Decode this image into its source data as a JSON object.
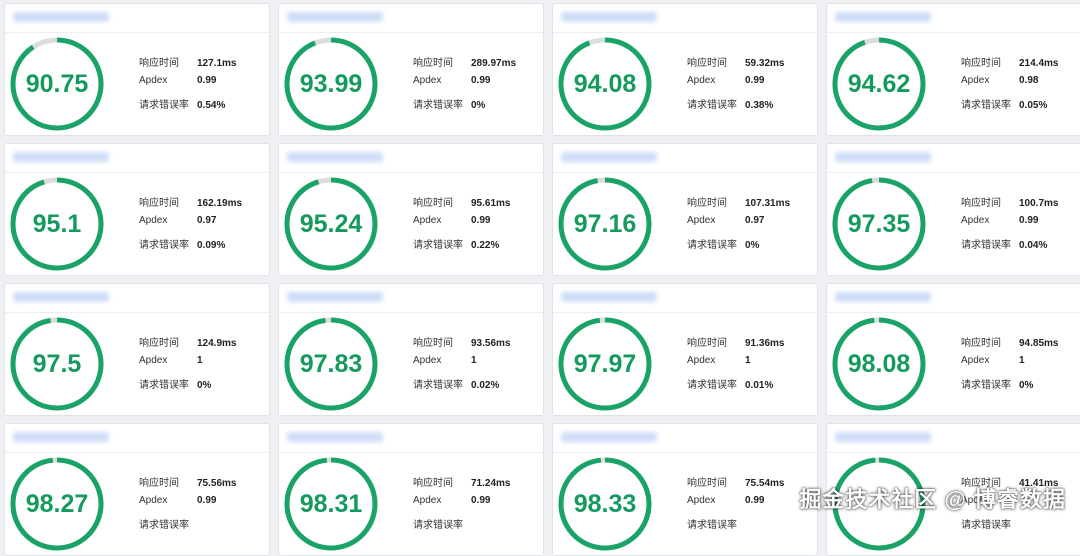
{
  "labels": {
    "response_time": "响应时间",
    "apdex": "Apdex",
    "error_rate": "请求错误率"
  },
  "colors": {
    "gauge_fill": "#1aa366",
    "gauge_track": "#dcdcdc",
    "score_text": "#159a5e"
  },
  "cards": [
    {
      "score": "90.75",
      "fill": 0.9075,
      "response_time": "127.1ms",
      "apdex": "0.99",
      "error_rate": "0.54%"
    },
    {
      "score": "93.99",
      "fill": 0.9399,
      "response_time": "289.97ms",
      "apdex": "0.99",
      "error_rate": "0%"
    },
    {
      "score": "94.08",
      "fill": 0.9408,
      "response_time": "59.32ms",
      "apdex": "0.99",
      "error_rate": "0.38%"
    },
    {
      "score": "94.62",
      "fill": 0.9462,
      "response_time": "214.4ms",
      "apdex": "0.98",
      "error_rate": "0.05%"
    },
    {
      "score": "95.1",
      "fill": 0.951,
      "response_time": "162.19ms",
      "apdex": "0.97",
      "error_rate": "0.09%"
    },
    {
      "score": "95.24",
      "fill": 0.9524,
      "response_time": "95.61ms",
      "apdex": "0.99",
      "error_rate": "0.22%"
    },
    {
      "score": "97.16",
      "fill": 0.9716,
      "response_time": "107.31ms",
      "apdex": "0.97",
      "error_rate": "0%"
    },
    {
      "score": "97.35",
      "fill": 0.9735,
      "response_time": "100.7ms",
      "apdex": "0.99",
      "error_rate": "0.04%"
    },
    {
      "score": "97.5",
      "fill": 0.975,
      "response_time": "124.9ms",
      "apdex": "1",
      "error_rate": "0%"
    },
    {
      "score": "97.83",
      "fill": 0.9783,
      "response_time": "93.56ms",
      "apdex": "1",
      "error_rate": "0.02%"
    },
    {
      "score": "97.97",
      "fill": 0.9797,
      "response_time": "91.36ms",
      "apdex": "1",
      "error_rate": "0.01%"
    },
    {
      "score": "98.08",
      "fill": 0.9808,
      "response_time": "94.85ms",
      "apdex": "1",
      "error_rate": "0%"
    },
    {
      "score": "98.27",
      "fill": 0.9827,
      "response_time": "75.56ms",
      "apdex": "0.99",
      "error_rate": ""
    },
    {
      "score": "98.31",
      "fill": 0.9831,
      "response_time": "71.24ms",
      "apdex": "0.99",
      "error_rate": ""
    },
    {
      "score": "98.33",
      "fill": 0.9833,
      "response_time": "75.54ms",
      "apdex": "0.99",
      "error_rate": ""
    },
    {
      "score": "",
      "fill": 0.985,
      "response_time": "41.41ms",
      "apdex": "",
      "error_rate": ""
    }
  ],
  "watermark": "掘金技术社区 @ 博睿数据"
}
